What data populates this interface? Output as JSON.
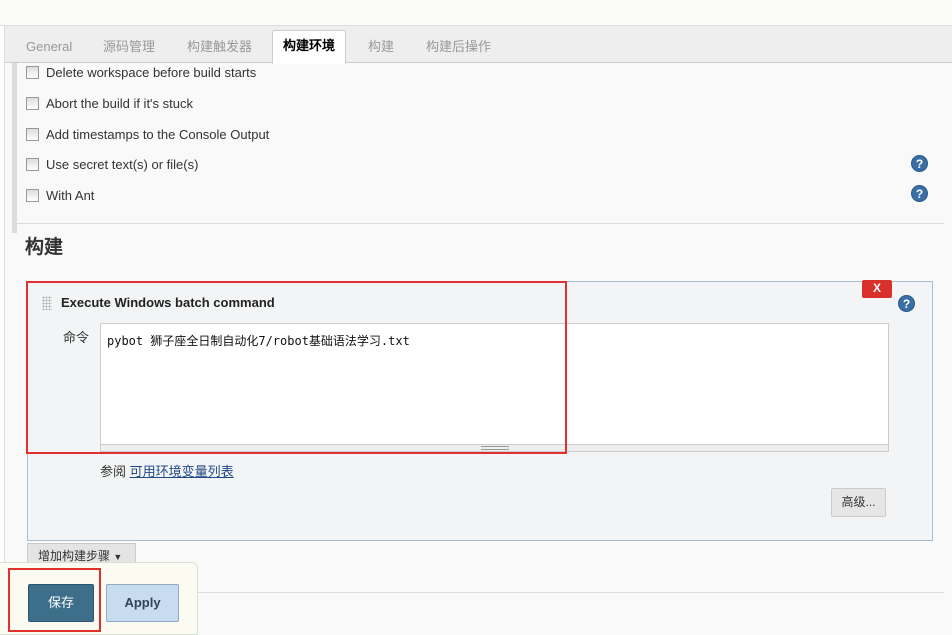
{
  "tabs": [
    "General",
    "源码管理",
    "构建触发器",
    "构建环境",
    "构建",
    "构建后操作"
  ],
  "active_tab": "构建环境",
  "env_options": [
    {
      "label": "Delete workspace before build starts",
      "checked": false,
      "help": false
    },
    {
      "label": "Abort the build if it's stuck",
      "checked": false,
      "help": false
    },
    {
      "label": "Add timestamps to the Console Output",
      "checked": false,
      "help": false
    },
    {
      "label": "Use secret text(s) or file(s)",
      "checked": false,
      "help": true
    },
    {
      "label": "With Ant",
      "checked": false,
      "help": true
    }
  ],
  "build": {
    "heading": "构建",
    "step_title": "Execute Windows batch command",
    "delete_label": "X",
    "help_label": "?",
    "command_label": "命令",
    "command_value": "pybot 狮子座全日制自动化7/robot基础语法学习.txt",
    "see_prefix": "参阅",
    "env_link": "可用环境变量列表",
    "advanced": "高级...",
    "add_step": "增加构建步骤",
    "add_step_arrow": "▼"
  },
  "footer": {
    "save": "保存",
    "apply": "Apply"
  },
  "colors": {
    "highlight": "#e03030",
    "save": "#3d6f8a",
    "help": "#3a6ea5"
  }
}
